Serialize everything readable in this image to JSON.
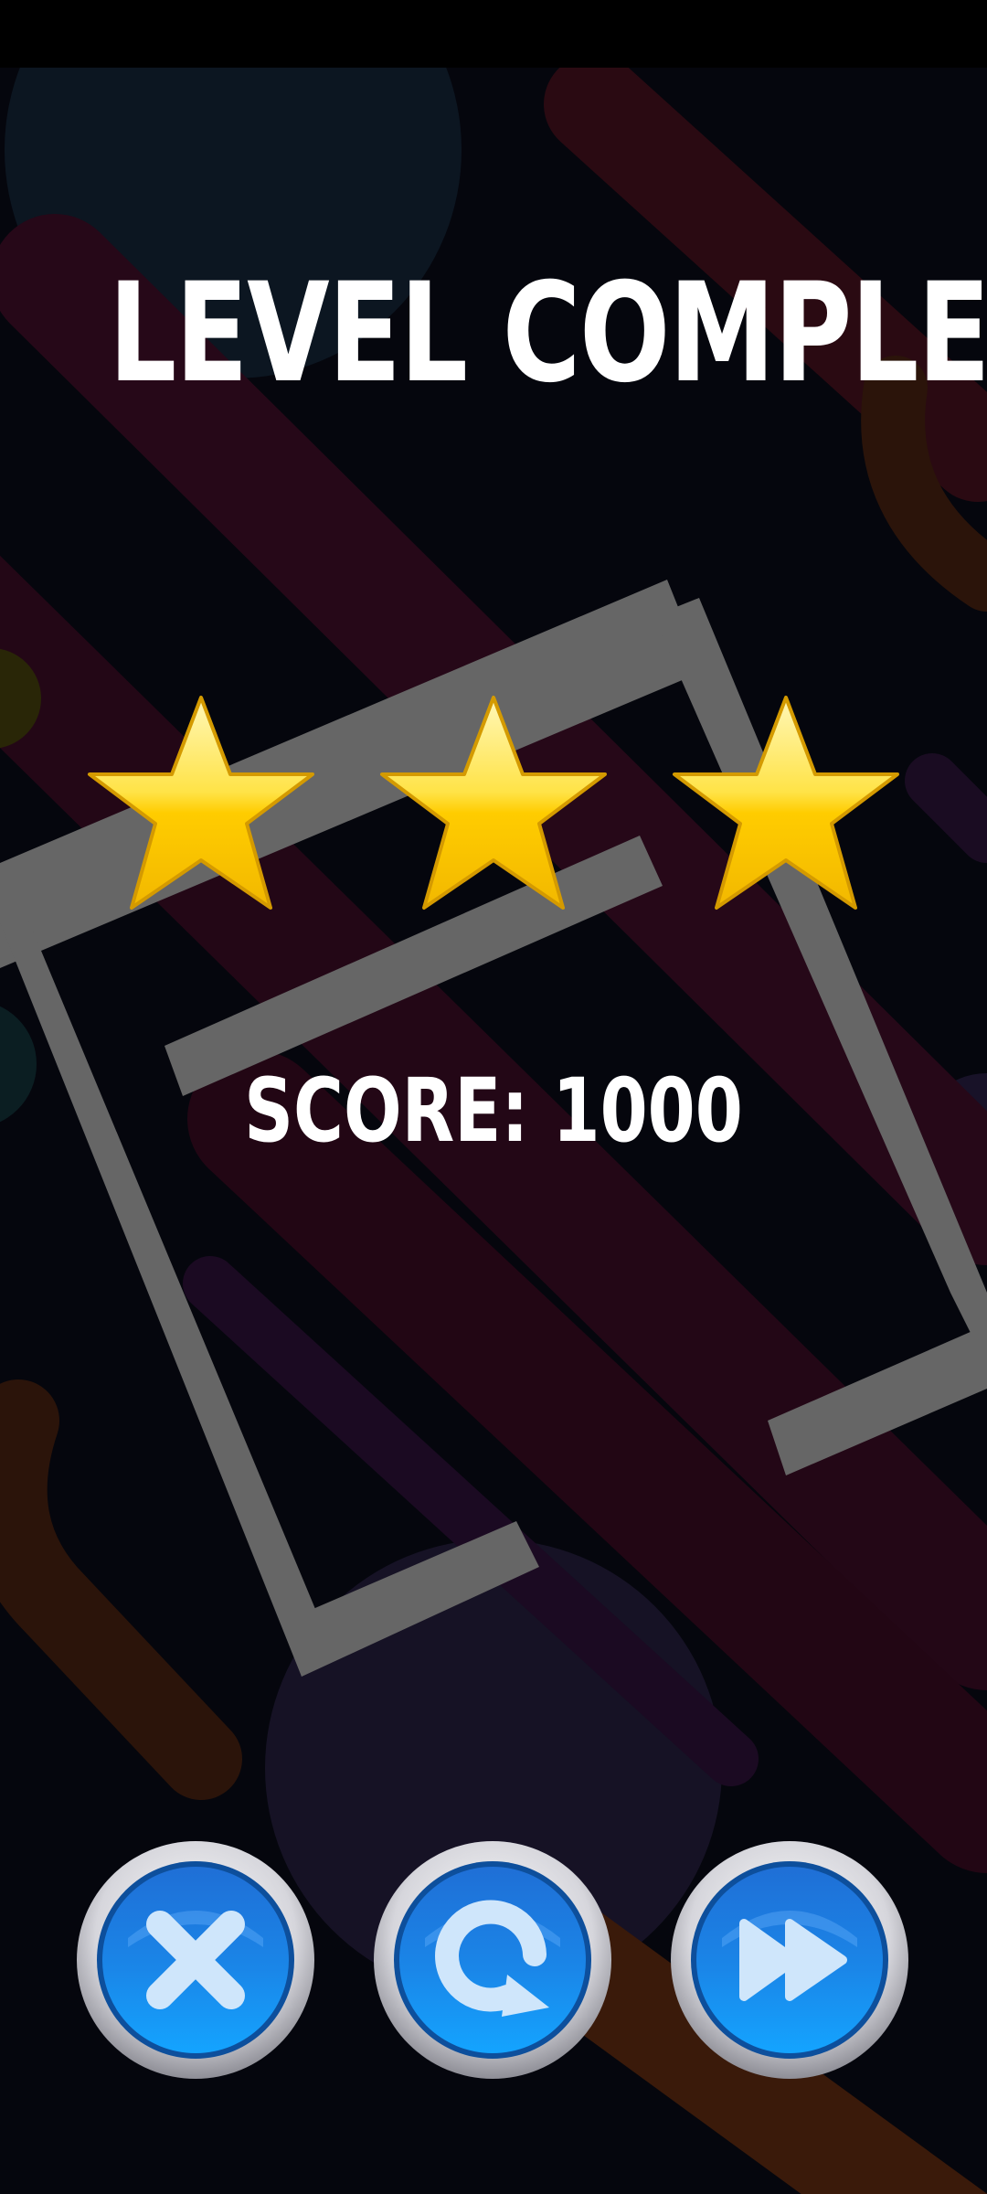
{
  "title": "LEVEL COMPLETE",
  "score": {
    "label": "SCORE:",
    "value": "1000",
    "display": "SCORE: 1000"
  },
  "stars": {
    "earned": 3,
    "total": 3
  },
  "buttons": [
    {
      "name": "close-button",
      "icon": "close-x-icon"
    },
    {
      "name": "replay-button",
      "icon": "replay-arrow-icon"
    },
    {
      "name": "next-level-button",
      "icon": "fast-forward-icon"
    }
  ],
  "colors": {
    "background": "#05060d",
    "title_text": "#ffffff",
    "star_gold": "#ffd21a",
    "button_blue": "#1a86e8",
    "button_rim": "#c9c9cf",
    "frame_gray": "#6b6b6b"
  }
}
